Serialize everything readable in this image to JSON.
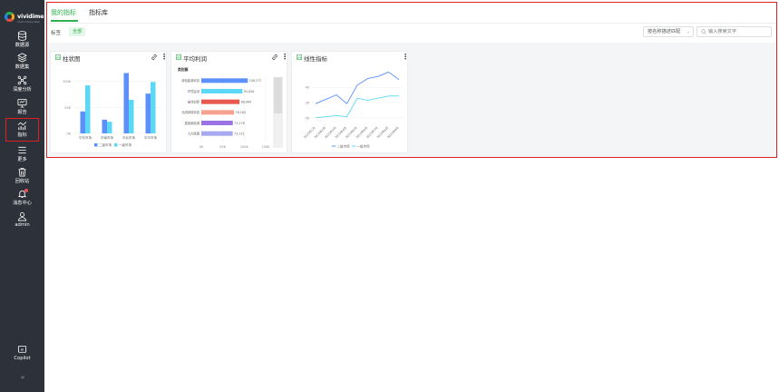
{
  "logo": {
    "brand": "vividime",
    "slogan": "Vivid In Every Step"
  },
  "sidebar": {
    "items": [
      {
        "label": "数据源",
        "icon": "database-icon"
      },
      {
        "label": "数据集",
        "icon": "dataset-layers-icon"
      },
      {
        "label": "深度分析",
        "icon": "network-analysis-icon"
      },
      {
        "label": "报告",
        "icon": "report-monitor-icon"
      },
      {
        "label": "指标",
        "icon": "metrics-chart-icon",
        "active": true
      },
      {
        "label": "更多",
        "icon": "menu-icon"
      },
      {
        "label": "回收站",
        "icon": "trash-icon"
      },
      {
        "label": "消息中心",
        "icon": "bell-icon",
        "badge": true
      },
      {
        "label": "admin",
        "icon": "user-icon"
      }
    ],
    "copilot": {
      "label": "Copilot",
      "icon_text": "AI"
    },
    "collapse_glyph": "«"
  },
  "tabs": [
    {
      "label": "我的指标",
      "active": true
    },
    {
      "label": "指标库",
      "active": false
    }
  ],
  "filter": {
    "tag_label": "标签",
    "tag_all": "全部"
  },
  "search": {
    "match_mode": "按名称描述匹配",
    "placeholder": "输入搜索文字"
  },
  "colors": {
    "accent": "#2fb24f",
    "sidebar_bg": "#2d3139",
    "highlight": "#e02020"
  },
  "cards": [
    {
      "title": "柱状图",
      "icon": "chart-card-icon"
    },
    {
      "title": "平均利润",
      "icon": "chart-card-icon"
    },
    {
      "title": "线性指标",
      "icon": "chart-card-icon"
    }
  ],
  "chart_data": [
    {
      "type": "bar",
      "categories": [
        "华东市场",
        "华南市场",
        "华北市场",
        "华中市场"
      ],
      "series": [
        {
          "name": "二级市场",
          "color": "#5b8ff9",
          "values": [
            3200,
            2000,
            8800,
            5800
          ]
        },
        {
          "name": "一级市场",
          "color": "#5ad8f5",
          "values": [
            7000,
            1700,
            4900,
            7500
          ]
        }
      ],
      "yticks": [
        "0K",
        "50K",
        "100K"
      ],
      "ylim": [
        0,
        9000
      ]
    },
    {
      "type": "bar",
      "orientation": "horizontal",
      "legend_title": "类别簇",
      "categories": [
        "绿色能源科技",
        "环境监测",
        "最佳创新",
        "无线网络科技",
        "直接新能源",
        "九大联盟"
      ],
      "values": [
        108277,
        95826,
        88984,
        76162,
        73278,
        73121
      ],
      "value_labels": [
        "108,277",
        "95,826",
        "88,984",
        "76,162",
        "73,278",
        "73,121"
      ],
      "colors": [
        "#5b8ff9",
        "#5ad8f5",
        "#e8584f",
        "#f6a28f",
        "#9b72e4",
        "#a8a8f0"
      ],
      "xticks": [
        "0K",
        "50K",
        "100K",
        "150K"
      ],
      "xlim": [
        0,
        150000
      ]
    },
    {
      "type": "line",
      "x": [
        "2015年1月",
        "2015年2月",
        "2015年3月",
        "2015年4月",
        "2015年5月",
        "2015年6月",
        "2015年7月",
        "2015年8月",
        "2015年9月"
      ],
      "series": [
        {
          "name": "二级市场",
          "color": "#5b8ff9",
          "values": [
            13,
            17,
            21,
            13,
            30,
            36,
            38,
            42,
            35
          ]
        },
        {
          "name": "一级市场",
          "color": "#5ad8f5",
          "values": [
            0,
            1,
            2,
            1,
            18,
            16,
            18,
            20,
            20
          ]
        }
      ],
      "yticks": [
        "0K",
        "2K",
        "4K"
      ],
      "ylim": [
        -6,
        44
      ]
    }
  ]
}
